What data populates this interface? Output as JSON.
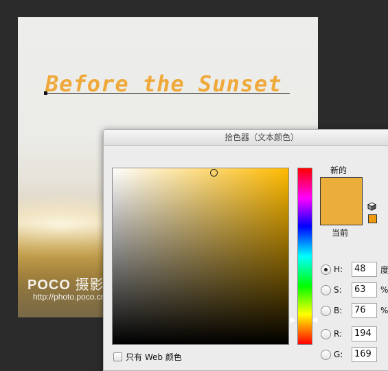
{
  "document": {
    "title_text": "Before the Sunset",
    "watermark_logo_a": "POCO",
    "watermark_logo_b": "摄影专题",
    "watermark_url": "http://photo.poco.cn/"
  },
  "color_picker": {
    "window_title": "拾色器（文本颜色）",
    "new_label": "新的",
    "current_label": "当前",
    "selected_color": "#ecae3a",
    "hue_marker_color": "#ffffff",
    "web_only_label": "只有 Web 颜色",
    "fields": [
      {
        "key": "H",
        "label": "H:",
        "value": "48",
        "unit": "度",
        "selected": true
      },
      {
        "key": "S",
        "label": "S:",
        "value": "63",
        "unit": "%",
        "selected": false
      },
      {
        "key": "B",
        "label": "B:",
        "value": "76",
        "unit": "%",
        "selected": false
      },
      {
        "key": "R",
        "label": "R:",
        "value": "194",
        "unit": "",
        "selected": false
      },
      {
        "key": "G",
        "label": "G:",
        "value": "169",
        "unit": "",
        "selected": false
      }
    ]
  },
  "icons": {
    "gamut_warning": "cube-icon",
    "websafe_swatch": "websafe-color-swatch"
  }
}
